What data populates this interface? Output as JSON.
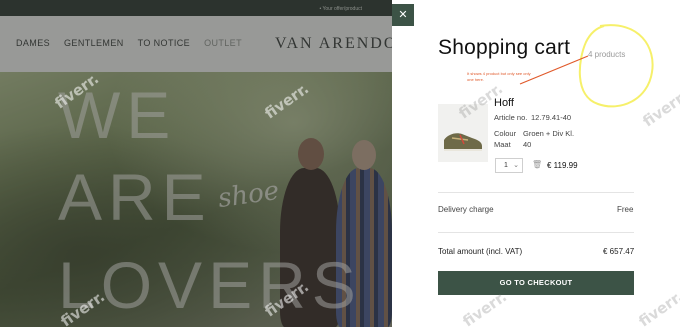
{
  "store": {
    "promo": "• Your offer/product",
    "nav": [
      "DAMES",
      "GENTLEMEN",
      "TO NOTICE",
      "OUTLET"
    ],
    "brand": "VAN ARENDONK",
    "hero_words": [
      "WE",
      "ARE",
      "LOVERS"
    ],
    "hero_script": "shoe"
  },
  "drawer": {
    "close_icon": "close-icon",
    "title": "Shopping cart",
    "product_count": "4 products",
    "note": "It shows 4 product but only see only one here.",
    "annotation_color": "#e0592a",
    "highlight_color": "#f6f06a"
  },
  "item": {
    "name": "Hoff",
    "article_label": "Article no.",
    "article_value": "12.79.41-40",
    "colour_label": "Colour",
    "colour_value": "Groen + Div Kl.",
    "size_label": "Maat",
    "size_value": "40",
    "quantity": "1",
    "price": "€ 119.99",
    "thumb_icon": "shoe-icon"
  },
  "summary": {
    "delivery_label": "Delivery charge",
    "delivery_value": "Free",
    "total_label": "Total amount (incl. VAT)",
    "total_value": "€ 657.47",
    "checkout_label": "GO TO CHECKOUT"
  },
  "watermark": "fiverr.",
  "colors": {
    "accent": "#3c5346"
  }
}
